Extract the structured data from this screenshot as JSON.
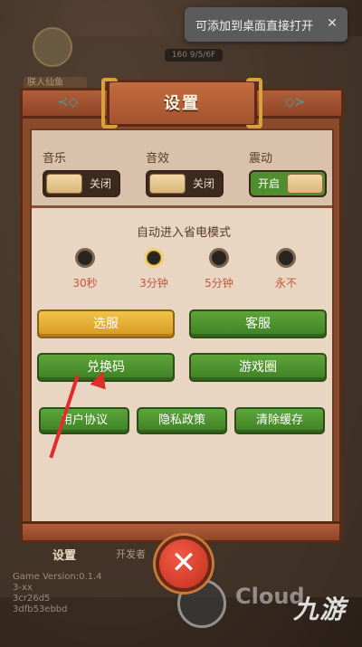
{
  "toast": {
    "text": "可添加到桌面直接打开",
    "close": "✕"
  },
  "background": {
    "chip": "160 9/5/6F",
    "name": "朕人仙鱼",
    "bottom_tab": "设置",
    "bottom_tab2": "开发者",
    "version": "Game Version:0.1.4\n3-xx\n3cr26d5\n3dfb53ebbd",
    "watermark": "九游",
    "watermark_sub": "Cloud"
  },
  "dialog": {
    "title": "设置",
    "toggles": [
      {
        "label": "音乐",
        "state": "关闭",
        "on": false
      },
      {
        "label": "音效",
        "state": "关闭",
        "on": false
      },
      {
        "label": "震动",
        "state": "开启",
        "on": true
      }
    ],
    "power_save": {
      "title": "自动进入省电模式",
      "options": [
        "30秒",
        "3分钟",
        "5分钟",
        "永不"
      ],
      "selected": "3分钟"
    },
    "buttons_row1": [
      "选服",
      "客服"
    ],
    "buttons_row2": [
      "兑换码",
      "游戏圈"
    ],
    "buttons_row3": [
      "用户协议",
      "隐私政策",
      "清除缓存"
    ],
    "close_icon": "✕"
  },
  "colors": {
    "accent_green": "#4f8e2f",
    "accent_gold": "#f1c24a",
    "wood": "#8a4a2c",
    "arrow": "#e22b2b"
  }
}
